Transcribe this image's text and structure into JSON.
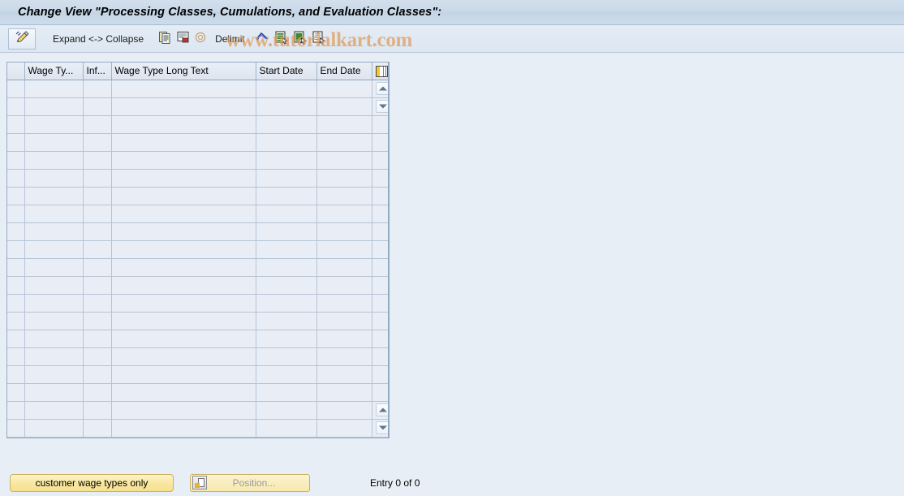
{
  "window": {
    "title": "Change View \"Processing Classes, Cumulations, and Evaluation Classes\":"
  },
  "toolbar": {
    "edit_icon": "pencil-icon",
    "expand_collapse_label": "Expand <-> Collapse",
    "delimit_label": "Delimit",
    "icons": [
      "copy-icon",
      "copy-as-icon",
      "delimit-circle-icon",
      "undo-icon",
      "select-all-icon",
      "select-block-icon",
      "deselect-icon"
    ]
  },
  "watermark": {
    "text": "www.tutorialkart.com",
    "color": "#e09a5a"
  },
  "grid": {
    "columns": [
      {
        "id": "wage_type",
        "label": "Wage Ty...",
        "width": 72
      },
      {
        "id": "infotype",
        "label": "Inf...",
        "width": 35
      },
      {
        "id": "wage_type_long_text",
        "label": "Wage Type Long Text",
        "width": 178
      },
      {
        "id": "start_date",
        "label": "Start Date",
        "width": 75
      },
      {
        "id": "end_date",
        "label": "End Date",
        "width": 70
      }
    ],
    "config_icon": "table-settings-icon",
    "scroll": {
      "top_up": "scroll-up-icon",
      "top_down": "scroll-down-icon",
      "bottom_up": "scroll-page-up-icon",
      "bottom_down": "scroll-page-down-icon"
    },
    "row_count": 20,
    "rows": []
  },
  "footer": {
    "customer_wage_types_button": "customer wage types only",
    "position_button": "Position...",
    "position_icon": "position-icon",
    "entry_status": "Entry 0 of 0"
  }
}
